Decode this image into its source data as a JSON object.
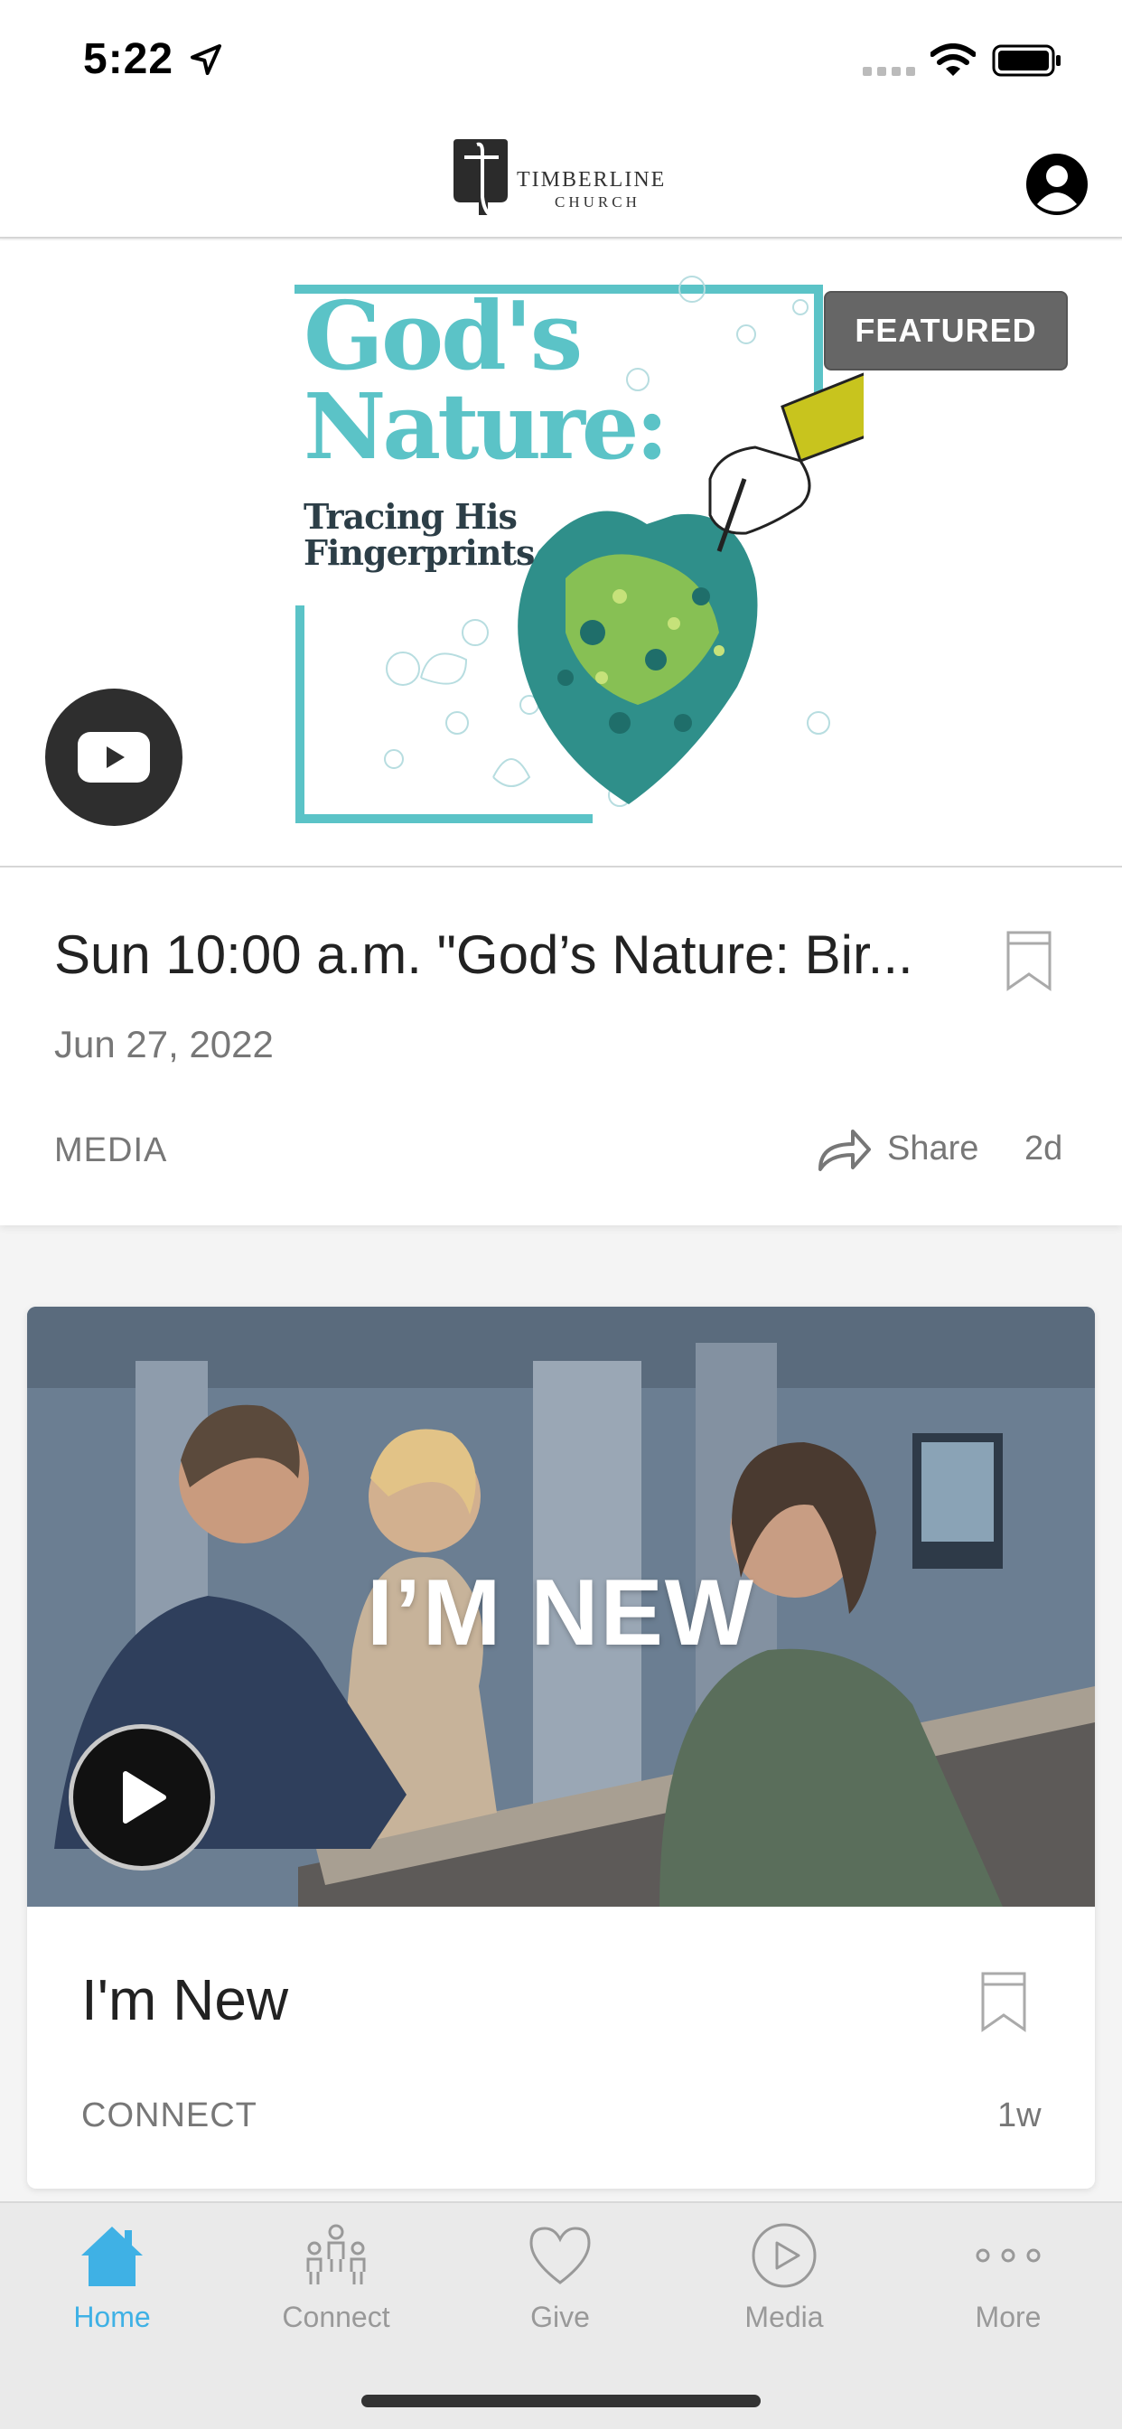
{
  "status_bar": {
    "time": "5:22",
    "icons": [
      "location-arrow-icon",
      "cellular-signal-icon",
      "wifi-icon",
      "battery-icon"
    ]
  },
  "header": {
    "logo_name": "TIMBERLINE",
    "logo_sub": "CHURCH",
    "profile_icon": "person-circle-icon"
  },
  "featured": {
    "badge": "FEATURED",
    "artwork": {
      "title_line_1": "God's",
      "title_line_2": "Nature:",
      "subtitle": "Tracing His Fingerprints"
    },
    "media_icon": "youtube-icon",
    "title": "Sun 10:00 a.m. \"God’s Nature: Bir...",
    "date": "Jun 27, 2022",
    "category": "MEDIA",
    "share_label": "Share",
    "age": "2d"
  },
  "new_card": {
    "overlay_text": "I’M NEW",
    "title": "I'm New",
    "category": "CONNECT",
    "age": "1w"
  },
  "tabs": [
    {
      "label": "Home",
      "icon": "home-icon",
      "active": true
    },
    {
      "label": "Connect",
      "icon": "people-icon",
      "active": false
    },
    {
      "label": "Give",
      "icon": "heart-icon",
      "active": false
    },
    {
      "label": "Media",
      "icon": "play-circle-icon",
      "active": false
    },
    {
      "label": "More",
      "icon": "more-dots-icon",
      "active": false
    }
  ],
  "colors": {
    "accent": "#3fb1e5",
    "art_teal": "#5bc3c7",
    "muted_text": "#777777"
  }
}
